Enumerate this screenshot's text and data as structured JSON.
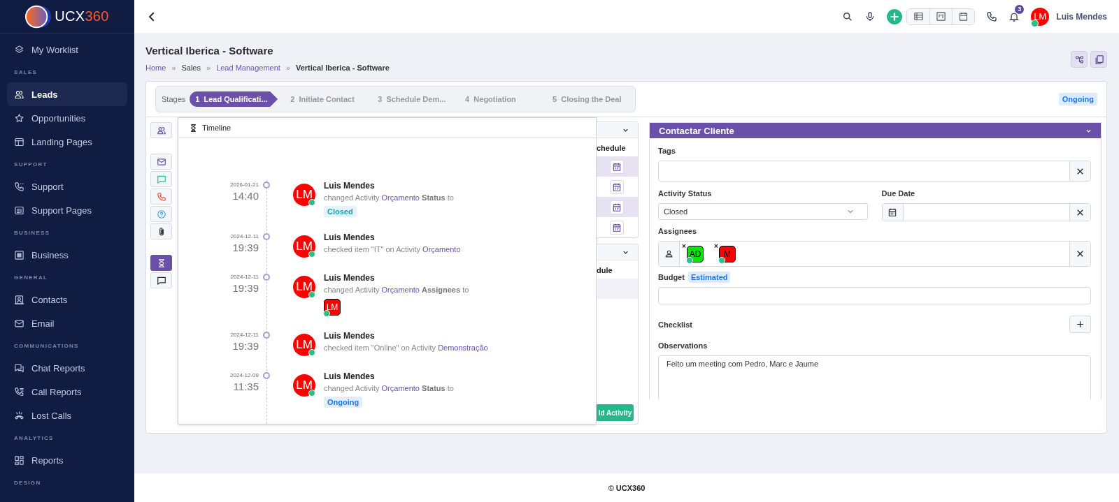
{
  "sidebar": {
    "logo": {
      "text": "UCX",
      "accent": "360"
    },
    "nav": [
      {
        "kind": "item",
        "label": "My Worklist",
        "selected": false
      },
      {
        "kind": "section",
        "label": "SALES"
      },
      {
        "kind": "item",
        "label": "Leads",
        "selected": true
      },
      {
        "kind": "item",
        "label": "Opportunities",
        "selected": false
      },
      {
        "kind": "item",
        "label": "Landing Pages",
        "selected": false
      },
      {
        "kind": "section",
        "label": "SUPPORT"
      },
      {
        "kind": "item",
        "label": "Support",
        "selected": false
      },
      {
        "kind": "item",
        "label": "Support Pages",
        "selected": false
      },
      {
        "kind": "section",
        "label": "BUSINESS"
      },
      {
        "kind": "item",
        "label": "Business",
        "selected": false
      },
      {
        "kind": "section",
        "label": "GENERAL"
      },
      {
        "kind": "item",
        "label": "Contacts",
        "selected": false
      },
      {
        "kind": "item",
        "label": "Email",
        "selected": false
      },
      {
        "kind": "section",
        "label": "COMMUNICATIONS"
      },
      {
        "kind": "item",
        "label": "Chat Reports",
        "selected": false
      },
      {
        "kind": "item",
        "label": "Call Reports",
        "selected": false
      },
      {
        "kind": "item",
        "label": "Lost Calls",
        "selected": false
      },
      {
        "kind": "section",
        "label": "ANALYTICS"
      },
      {
        "kind": "item",
        "label": "Reports",
        "selected": false
      },
      {
        "kind": "section",
        "label": "DESIGN"
      }
    ]
  },
  "topbar": {
    "notifications": "3",
    "user": {
      "initials": "LM",
      "online": true,
      "name": "Luis Mendes"
    }
  },
  "page": {
    "title": "Vertical Iberica - Software",
    "breadcrumb": [
      {
        "label": "Home",
        "link": true
      },
      {
        "label": "Sales",
        "link": false
      },
      {
        "label": "Lead Management",
        "link": true
      },
      {
        "label": "Vertical Iberica - Software",
        "link": false
      }
    ],
    "separator": "»"
  },
  "stages": {
    "label": "Stages",
    "status": "Ongoing",
    "items": [
      {
        "number": "1",
        "label": "Lead Qualificati...",
        "selected": true
      },
      {
        "number": "2",
        "label": "Initiate Contact",
        "selected": false
      },
      {
        "number": "3",
        "label": "Schedule Dem...",
        "selected": false
      },
      {
        "number": "4",
        "label": "Negotiation",
        "selected": false
      },
      {
        "number": "5",
        "label": "Closing the Deal",
        "selected": false
      }
    ]
  },
  "tool_buttons": [
    {
      "kind": "people",
      "selected": false
    },
    {
      "kind": "gap"
    },
    {
      "kind": "mail",
      "selected": false
    },
    {
      "kind": "chat",
      "selected": false
    },
    {
      "kind": "phone",
      "selected": false
    },
    {
      "kind": "help",
      "selected": false
    },
    {
      "kind": "clip",
      "selected": false
    },
    {
      "kind": "gap"
    },
    {
      "kind": "timeline",
      "selected": true
    },
    {
      "kind": "comment",
      "selected": false
    }
  ],
  "timeline": {
    "title": "Timeline",
    "entries": [
      {
        "date": "2026-01-21",
        "time": "14:40",
        "initials": "LM",
        "online": true,
        "name": "Luis Mendes",
        "description": [
          {
            "kind": "plain",
            "text": "changed Activity"
          },
          {
            "kind": "link",
            "text": "Orçamento"
          },
          {
            "kind": "bold",
            "text": "Status"
          },
          {
            "kind": "plain",
            "text": "to"
          }
        ],
        "badge": {
          "text": "Closed",
          "color": "#1a9fb4"
        }
      },
      {
        "date": "2024-12-11",
        "time": "19:39",
        "initials": "LM",
        "online": true,
        "name": "Luis Mendes",
        "description": [
          {
            "kind": "plain",
            "text": "checked item \"IT\" on Activity"
          },
          {
            "kind": "link",
            "text": "Orçamento"
          }
        ]
      },
      {
        "date": "2024-12-11",
        "time": "19:39",
        "initials": "LM",
        "online": true,
        "name": "Luis Mendes",
        "description": [
          {
            "kind": "plain",
            "text": "changed Activity"
          },
          {
            "kind": "link",
            "text": "Orçamento"
          },
          {
            "kind": "bold",
            "text": "Assignees"
          },
          {
            "kind": "plain",
            "text": "to"
          }
        ],
        "assignee": {
          "initials": "LM",
          "online": true
        }
      },
      {
        "date": "2024-12-11",
        "time": "19:39",
        "initials": "LM",
        "online": true,
        "name": "Luis Mendes",
        "description": [
          {
            "kind": "plain",
            "text": "checked item \"Online\" on Activity"
          },
          {
            "kind": "link",
            "text": "Demonstração"
          }
        ]
      },
      {
        "date": "2024-12-09",
        "time": "11:35",
        "initials": "LM",
        "online": true,
        "name": "Luis Mendes",
        "description": [
          {
            "kind": "plain",
            "text": "changed Activity"
          },
          {
            "kind": "link",
            "text": "Orçamento"
          },
          {
            "kind": "bold",
            "text": "Status"
          },
          {
            "kind": "plain",
            "text": "to"
          }
        ],
        "badge": {
          "text": "Ongoing",
          "color": "#1877f2"
        }
      }
    ]
  },
  "activities": {
    "column_1": "chedule",
    "column_2": "dule",
    "button": "ld Activity"
  },
  "activity": {
    "title": "Contactar Cliente",
    "tags": {
      "label": "Tags"
    },
    "status": {
      "label": "Activity Status",
      "value": "Closed"
    },
    "due_date": {
      "label": "Due Date"
    },
    "assignees": {
      "label": "Assignees",
      "items": [
        {
          "initials": "AD",
          "color": "#11e011",
          "remove": "×",
          "online": true
        },
        {
          "initials": "M",
          "color": "#ff0000",
          "remove": "×",
          "online": true
        }
      ]
    },
    "budget": {
      "label": "Budget",
      "badge": "Estimated"
    },
    "checklist": {
      "label": "Checklist"
    },
    "observations": {
      "label": "Observations",
      "value": "Feito um meeting com Pedro, Marc e Jaume"
    }
  },
  "footer": {
    "text": "© UCX360"
  }
}
